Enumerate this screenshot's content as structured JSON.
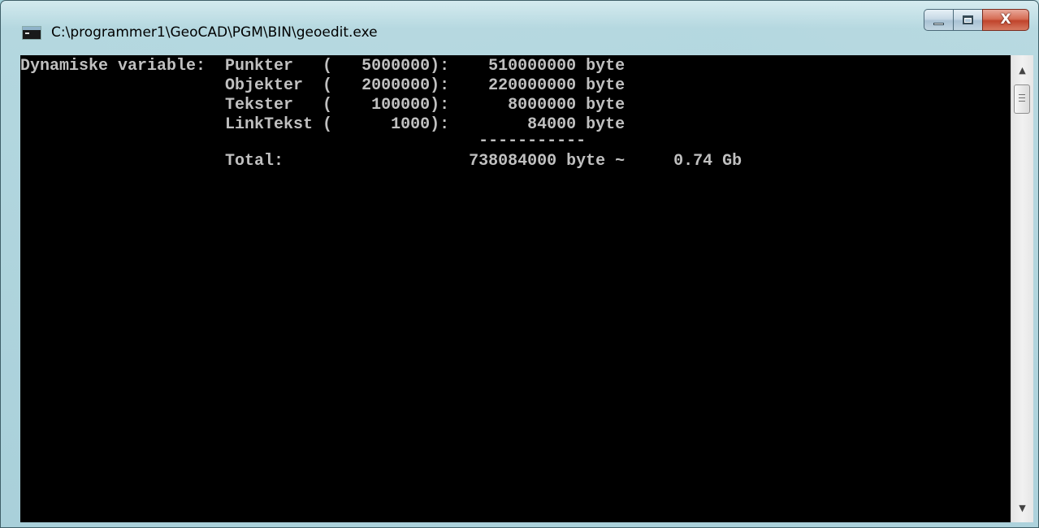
{
  "window": {
    "title": "C:\\programmer1\\GeoCAD\\PGM\\BIN\\geoedit.exe",
    "controls": {
      "minimize_icon": "minimize-icon",
      "maximize_icon": "maximize-icon",
      "close_label": "X"
    }
  },
  "console": {
    "lines": [
      "Dynamiske variable:  Punkter   (   5000000):    510000000 byte",
      "                     Objekter  (   2000000):    220000000 byte",
      "                     Tekster   (    100000):      8000000 byte",
      "                     LinkTekst (      1000):        84000 byte",
      "                                               -----------",
      "                     Total:                   738084000 byte ~     0.74 Gb"
    ],
    "colors": {
      "background": "#000000",
      "text": "#c0c0c0"
    }
  },
  "scrollbar": {
    "up_icon": "scroll-up-arrow-icon",
    "down_icon": "scroll-down-arrow-icon"
  }
}
